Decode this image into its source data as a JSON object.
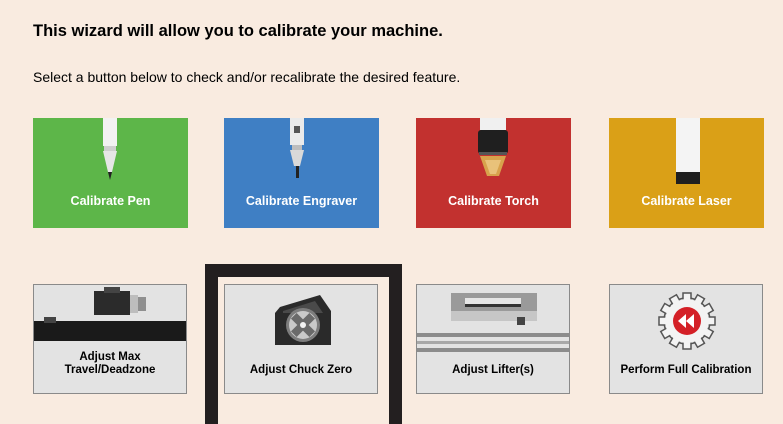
{
  "header": {
    "title": "This wizard will allow you to calibrate your machine.",
    "subtitle": "Select a button below to check and/or recalibrate the desired feature."
  },
  "tools": [
    {
      "label": "Calibrate Pen",
      "color": "#5db649",
      "icon": "pen-icon"
    },
    {
      "label": "Calibrate Engraver",
      "color": "#3f7fc4",
      "icon": "engraver-icon"
    },
    {
      "label": "Calibrate Torch",
      "color": "#c2312f",
      "icon": "torch-icon"
    },
    {
      "label": "Calibrate Laser",
      "color": "#daa017",
      "icon": "laser-icon"
    }
  ],
  "adjust": [
    {
      "label_line1": "Adjust Max",
      "label_line2": "Travel/Deadzone",
      "icon": "max-travel-icon"
    },
    {
      "label_line1": "Adjust Chuck Zero",
      "label_line2": "",
      "icon": "chuck-icon",
      "selected": true
    },
    {
      "label_line1": "Adjust Lifter(s)",
      "label_line2": "",
      "icon": "lifter-icon"
    },
    {
      "label_line1": "Perform Full Calibration",
      "label_line2": "",
      "icon": "full-calibration-icon"
    }
  ],
  "colors": {
    "background": "#f9ebe0",
    "tile_gray": "#e3e3e3",
    "selection_frame": "#231f20",
    "accent_red": "#d42027"
  }
}
